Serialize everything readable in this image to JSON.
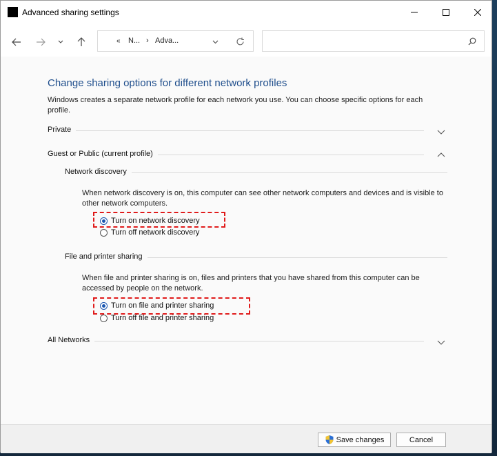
{
  "window": {
    "title": "Advanced sharing settings"
  },
  "address": {
    "seg1": "N...",
    "seg2": "Adva..."
  },
  "content": {
    "heading": "Change sharing options for different network profiles",
    "intro": "Windows creates a separate network profile for each network you use. You can choose specific options for each profile.",
    "private_label": "Private",
    "guest_label": "Guest or Public (current profile)",
    "network_discovery": {
      "label": "Network discovery",
      "desc": "When network discovery is on, this computer can see other network computers and devices and is visible to other network computers.",
      "on_label": "Turn on network discovery",
      "off_label": "Turn off network discovery"
    },
    "file_sharing": {
      "label": "File and printer sharing",
      "desc": "When file and printer sharing is on, files and printers that you have shared from this computer can be accessed by people on the network.",
      "on_label": "Turn on file and printer sharing",
      "off_label": "Turn off file and printer sharing"
    },
    "all_networks_label": "All Networks"
  },
  "footer": {
    "save_label": "Save changes",
    "cancel_label": "Cancel"
  },
  "colors": {
    "accent": "#1a56b0",
    "heading": "#1f4e8c",
    "highlight": "#e01a1a"
  }
}
